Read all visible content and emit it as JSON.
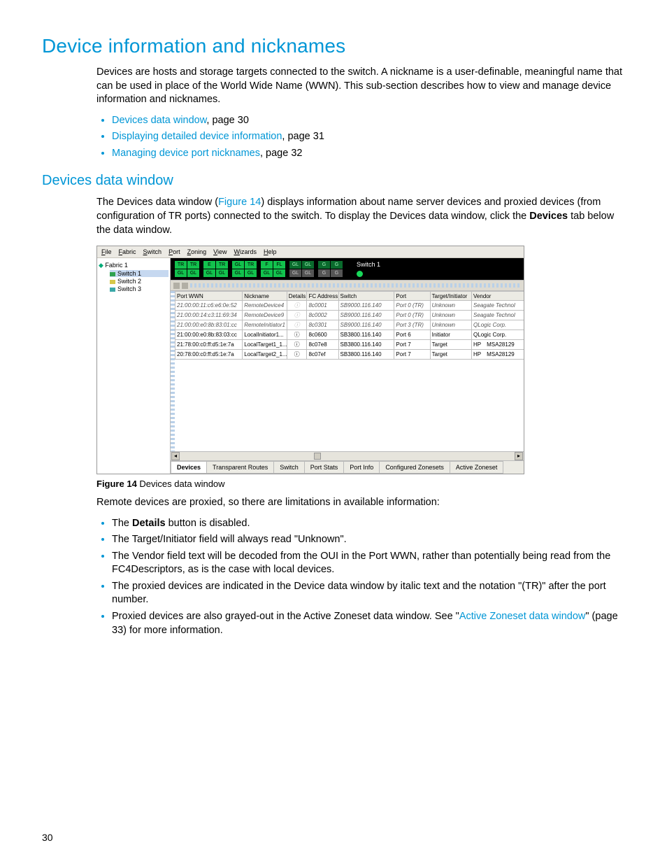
{
  "h1": "Device information and nicknames",
  "intro": "Devices are hosts and storage targets connected to the switch. A nickname is a user-definable, meaningful name that can be used in place of the World Wide Name (WWN). This sub-section describes how to view and manage device information and nicknames.",
  "toc": [
    {
      "link": "Devices data window",
      "rest": ", page 30"
    },
    {
      "link": "Displaying detailed device information",
      "rest": ", page 31"
    },
    {
      "link": "Managing device port nicknames",
      "rest": ", page 32"
    }
  ],
  "h2": "Devices data window",
  "sec_intro_a": "The Devices data window (",
  "sec_intro_link": "Figure 14",
  "sec_intro_b": ") displays information about name server devices and proxied devices (from configuration of TR ports) connected to the switch. To display the Devices data window, click the ",
  "sec_intro_bold": "Devices",
  "sec_intro_c": " tab below the data window.",
  "figure_label": "Figure 14",
  "figure_caption": "Devices data window",
  "remote_intro": "Remote devices are proxied, so there are limitations in available information:",
  "limits": [
    {
      "pre": "The ",
      "bold": "Details",
      "post": " button is disabled."
    },
    {
      "text": "The Target/Initiator field will always read \"Unknown\"."
    },
    {
      "text": "The Vendor field text will be decoded from the OUI in the Port WWN, rather than potentially being read from the FC4Descriptors, as is the case with local devices."
    },
    {
      "text": "The proxied devices are indicated in the Device data window by italic text and the notation \"(TR)\" after the port number."
    },
    {
      "pre": "Proxied devices are also grayed-out in the Active Zoneset data window. See \"",
      "link": "Active Zoneset data window",
      "post": "\" (page 33) for more information."
    }
  ],
  "page_number": "30",
  "app": {
    "menus": [
      "File",
      "Fabric",
      "Switch",
      "Port",
      "Zoning",
      "View",
      "Wizards",
      "Help"
    ],
    "tree": {
      "root": "Fabric 1",
      "children": [
        "Switch 1",
        "Switch 2",
        "Switch 3"
      ],
      "selected_index": 0
    },
    "switch_label": "Switch 1",
    "port_labels_row1": [
      "TR",
      "TR",
      "E",
      "TR",
      "GL",
      "TR",
      "F",
      "FL",
      "GL",
      "GL",
      "G",
      "G"
    ],
    "port_labels_row2": [
      "GL",
      "GL",
      "GL",
      "GL",
      "GL",
      "GL",
      "GL",
      "GL",
      "GL",
      "GL",
      "G",
      "G"
    ],
    "columns": [
      "Port WWN",
      "Nickname",
      "Details",
      "FC Address",
      "Switch",
      "Port",
      "Target/Initiator",
      "Vendor"
    ],
    "col_widths": [
      "94px",
      "62px",
      "28px",
      "44px",
      "78px",
      "50px",
      "58px",
      "78px"
    ],
    "rows": [
      {
        "proxy": true,
        "cells": [
          "21:00:00:11:c6:e6:0e:52",
          "RemoteDevice4",
          "(i)",
          "8c0001",
          "SB9000.116.140",
          "Port 0 (TR)",
          "Unknown",
          "Seagate Technol"
        ]
      },
      {
        "proxy": true,
        "cells": [
          "21:00:00:14:c3:11:69:34",
          "RemoteDevice9",
          "(i)",
          "8c0002",
          "SB9000.116.140",
          "Port 0 (TR)",
          "Unknown",
          "Seagate Technol"
        ]
      },
      {
        "proxy": true,
        "cells": [
          "21:00:00:e0:8b:83:01:cc",
          "RemoteInitiator1",
          "(i)",
          "8c0301",
          "SB9000.116.140",
          "Port 3 (TR)",
          "Unknown",
          "QLogic Corp."
        ]
      },
      {
        "proxy": false,
        "cells": [
          "21:00:00:e0:8b:83:03:cc",
          "LocalInitiator1...",
          "(i)",
          "8c0600",
          "SB3800.116.140",
          "Port 6",
          "Initiator",
          "QLogic Corp."
        ]
      },
      {
        "proxy": false,
        "cells": [
          "21:78:00:c0:ff:d5:1e:7a",
          "LocalTarget1_1...",
          "(i)",
          "8c07e8",
          "SB3800.116.140",
          "Port 7",
          "Target",
          "HP MSA28129"
        ]
      },
      {
        "proxy": false,
        "cells": [
          "20:78:00:c0:ff:d5:1e:7a",
          "LocalTarget2_1...",
          "(i)",
          "8c07ef",
          "SB3800.116.140",
          "Port 7",
          "Target",
          "HP MSA28129"
        ]
      }
    ],
    "tabs": [
      "Devices",
      "Transparent Routes",
      "Switch",
      "Port Stats",
      "Port Info",
      "Configured Zonesets",
      "Active Zoneset"
    ],
    "active_tab_index": 0
  }
}
